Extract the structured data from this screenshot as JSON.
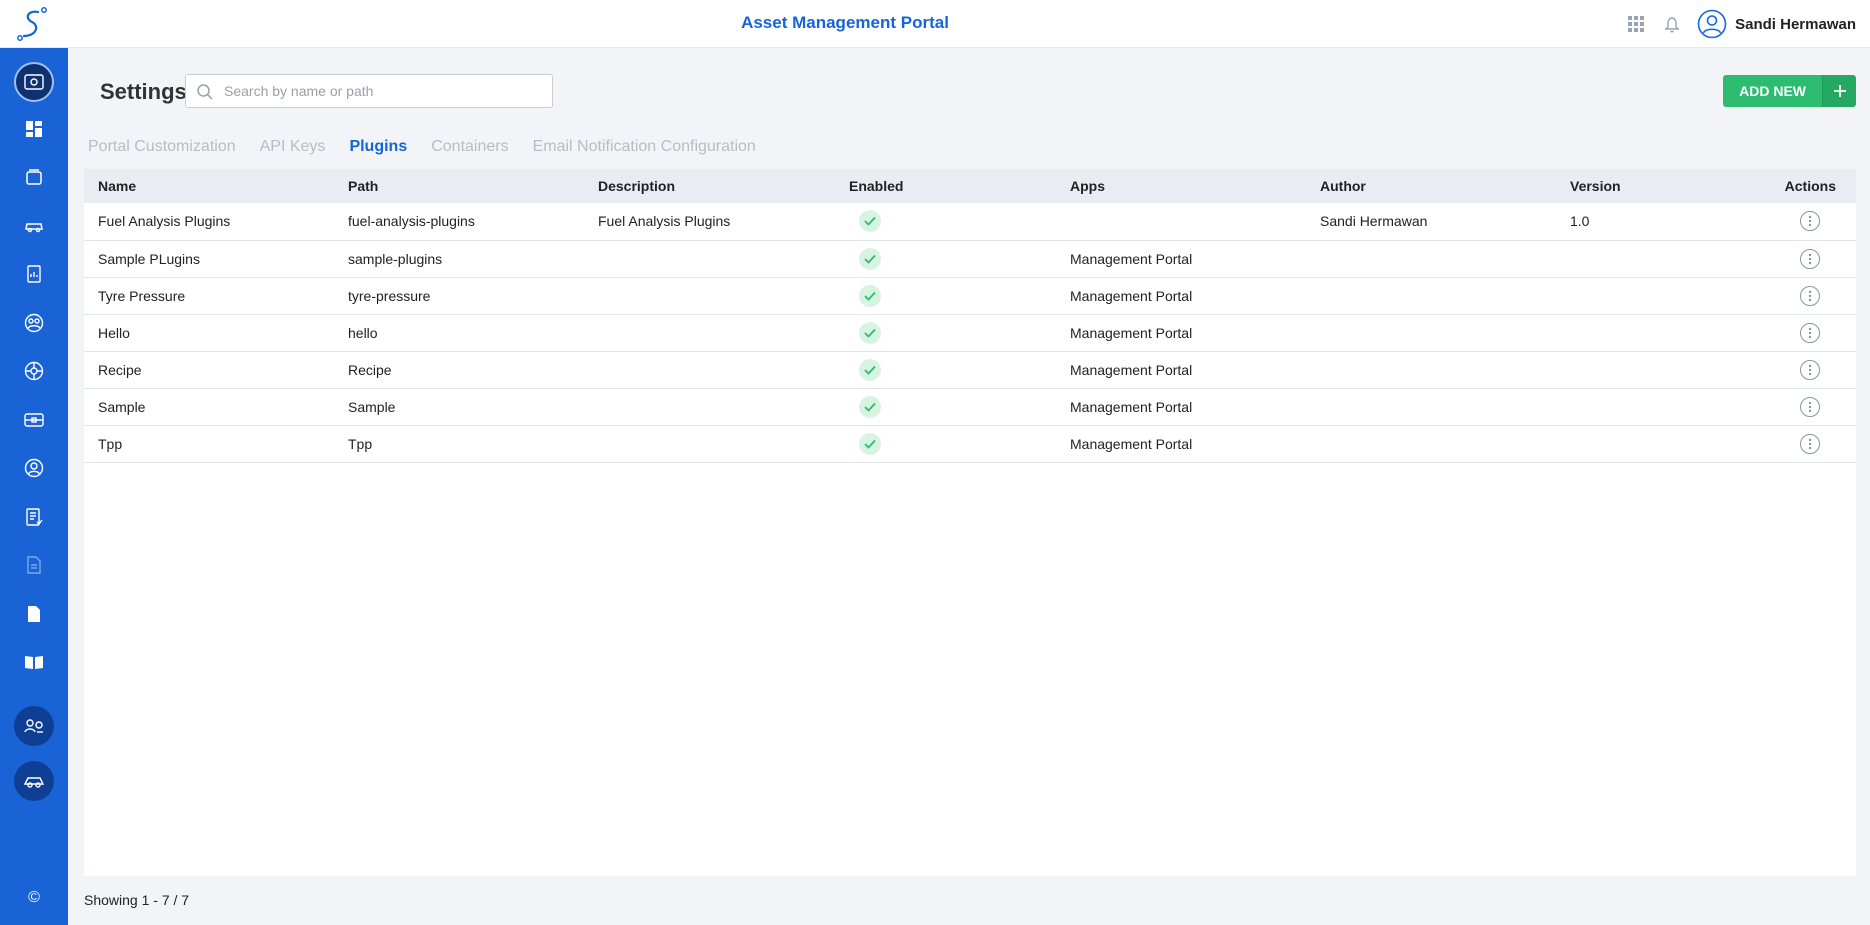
{
  "header": {
    "title": "Asset Management Portal",
    "user_name": "Sandi Hermawan",
    "icons": [
      "logo-icon",
      "apps-grid-icon",
      "notification-bell-icon",
      "user-avatar-icon"
    ]
  },
  "sidebar": {
    "items": [
      {
        "name": "settings-icon",
        "active": true
      },
      {
        "name": "dashboard-icon"
      },
      {
        "name": "assets-icon"
      },
      {
        "name": "vehicle-icon"
      },
      {
        "name": "reports-icon"
      },
      {
        "name": "groups-icon"
      },
      {
        "name": "services-icon"
      },
      {
        "name": "device-icon"
      },
      {
        "name": "user-profile-icon"
      },
      {
        "name": "tasks-icon"
      },
      {
        "name": "documents-icon"
      },
      {
        "name": "file-icon"
      },
      {
        "name": "book-icon"
      },
      {
        "name": "integrations-icon"
      },
      {
        "name": "fleet-icon"
      }
    ],
    "footer_symbol": "©"
  },
  "page": {
    "title": "Settings",
    "search_placeholder": "Search by name or path",
    "add_button_label": "ADD NEW"
  },
  "tabs": [
    {
      "label": "Portal Customization",
      "active": false
    },
    {
      "label": "API Keys",
      "active": false
    },
    {
      "label": "Plugins",
      "active": true
    },
    {
      "label": "Containers",
      "active": false
    },
    {
      "label": "Email Notification Configuration",
      "active": false
    }
  ],
  "table": {
    "columns": [
      "Name",
      "Path",
      "Description",
      "Enabled",
      "Apps",
      "Author",
      "Version",
      "Actions"
    ],
    "rows": [
      {
        "name": "Fuel Analysis Plugins",
        "path": "fuel-analysis-plugins",
        "description": "Fuel Analysis Plugins",
        "enabled": true,
        "apps": "",
        "author": "Sandi Hermawan",
        "version": "1.0"
      },
      {
        "name": "Sample PLugins",
        "path": "sample-plugins",
        "description": "",
        "enabled": true,
        "apps": "Management Portal",
        "author": "",
        "version": ""
      },
      {
        "name": "Tyre Pressure",
        "path": "tyre-pressure",
        "description": "",
        "enabled": true,
        "apps": "Management Portal",
        "author": "",
        "version": ""
      },
      {
        "name": "Hello",
        "path": "hello",
        "description": "",
        "enabled": true,
        "apps": "Management Portal",
        "author": "",
        "version": ""
      },
      {
        "name": "Recipe",
        "path": "Recipe",
        "description": "",
        "enabled": true,
        "apps": "Management Portal",
        "author": "",
        "version": ""
      },
      {
        "name": "Sample",
        "path": "Sample",
        "description": "",
        "enabled": true,
        "apps": "Management Portal",
        "author": "",
        "version": ""
      },
      {
        "name": "Tpp",
        "path": "Tpp",
        "description": "",
        "enabled": true,
        "apps": "Management Portal",
        "author": "",
        "version": ""
      }
    ]
  },
  "footer": {
    "showing": "Showing 1 - 7 / 7"
  },
  "colors": {
    "primary": "#1565d8",
    "sidebar": "#1a63d6",
    "success": "#2dbb70",
    "check_bg": "#d7f4e2",
    "check_fg": "#2dbb70"
  }
}
